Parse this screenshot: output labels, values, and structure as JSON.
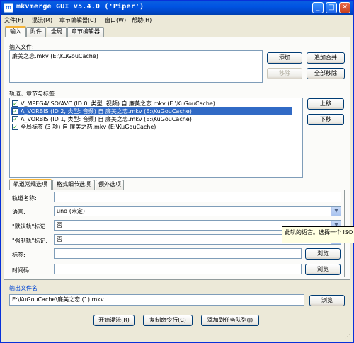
{
  "window": {
    "title": "mkvmerge GUI v5.4.0 ('Piper')"
  },
  "menu": [
    {
      "label": "文件(F)"
    },
    {
      "label": "混流(M)"
    },
    {
      "label": "章节编辑器(C)"
    },
    {
      "label": "窗口(W)"
    },
    {
      "label": "帮助(H)"
    }
  ],
  "tabs": [
    "输入",
    "附件",
    "全局",
    "章节编辑器"
  ],
  "input": {
    "label": "输入文件:",
    "files": [
      "廉美之恋.mkv (E:\\KuGouCache)"
    ],
    "buttons": {
      "add": "添加",
      "append": "追加合并",
      "remove": "移除",
      "remove_all": "全部移除"
    }
  },
  "tracks": {
    "label": "轨道、章节与标签:",
    "items": [
      {
        "text": "V_MPEG4/ISO/AVC (ID 0, 类型: 视频) 自 廉美之恋.mkv (E:\\KuGouCache)",
        "checked": true,
        "selected": false
      },
      {
        "text": "A_VORBIS (ID 2, 类型: 音频) 自 廉美之恋.mkv (E:\\KuGouCache)",
        "checked": true,
        "selected": true
      },
      {
        "text": "A_VORBIS (ID 1, 类型: 音频) 自 廉美之恋.mkv (E:\\KuGouCache)",
        "checked": true,
        "selected": false
      },
      {
        "text": "全局标签 (3 项) 自 廉美之恋.mkv (E:\\KuGouCache)",
        "checked": true,
        "selected": false
      }
    ],
    "buttons": {
      "up": "上移",
      "down": "下移"
    }
  },
  "options_tabs": [
    "轨道常规选项",
    "格式细节选项",
    "额外选项"
  ],
  "options": {
    "track_name_label": "轨道名称:",
    "track_name_value": "",
    "language_label": "语言:",
    "language_value": "und (未定)",
    "default_label": "\"默认轨\"标记:",
    "default_value": "否",
    "forced_label": "\"强制轨\"标记:",
    "forced_value": "否",
    "tags_label": "标签:",
    "tags_value": "",
    "timecodes_label": "时间码:",
    "timecodes_value": "",
    "browse": "浏览"
  },
  "tooltip": "此轨的语言。选择一个 ISO",
  "output": {
    "label": "输出文件名",
    "value": "E:\\KuGouCache\\廉美之恋 (1).mkv",
    "browse": "浏览"
  },
  "bottom_buttons": {
    "start": "开始混流(R)",
    "copy": "复制命令行(C)",
    "queue": "添加到任务队列(J)"
  },
  "colors": {
    "titlebar": "#0054e3",
    "selection": "#316ac5",
    "window_bg": "#ece9d8"
  }
}
